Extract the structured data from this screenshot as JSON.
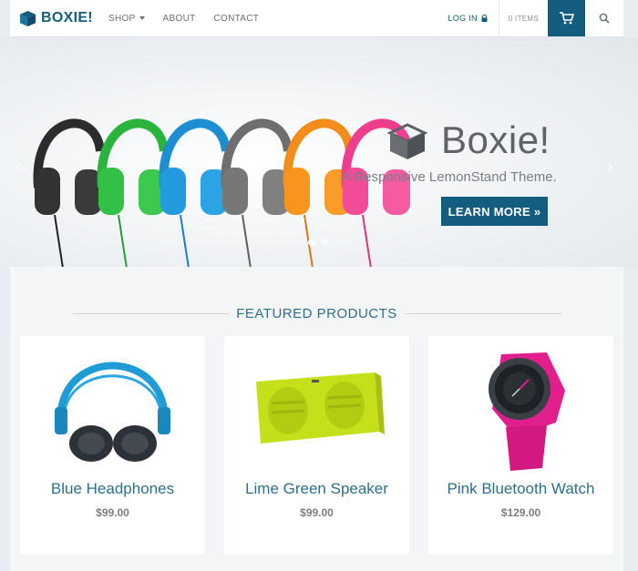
{
  "brand": {
    "name": "BOXIE!"
  },
  "nav": {
    "shop": "SHOP",
    "about": "ABOUT",
    "contact": "CONTACT",
    "login": "LOG IN",
    "items": "0 ITEMS"
  },
  "hero": {
    "title": "Boxie!",
    "subtitle": "A Responsive LemonStand Theme.",
    "button": "LEARN MORE »",
    "prev_arrow": "‹",
    "next_arrow": "›"
  },
  "featured": {
    "heading": "FEATURED PRODUCTS",
    "products": [
      {
        "name": "Blue Headphones",
        "price": "$99.00"
      },
      {
        "name": "Lime Green Speaker",
        "price": "$99.00"
      },
      {
        "name": "Pink Bluetooth Watch",
        "price": "$129.00"
      }
    ]
  },
  "colors": {
    "primary": "#145d7e",
    "link": "#2e6f8c"
  },
  "icons": [
    "box-logo-icon",
    "lock-icon",
    "cart-icon",
    "search-icon",
    "caret-down-icon"
  ]
}
